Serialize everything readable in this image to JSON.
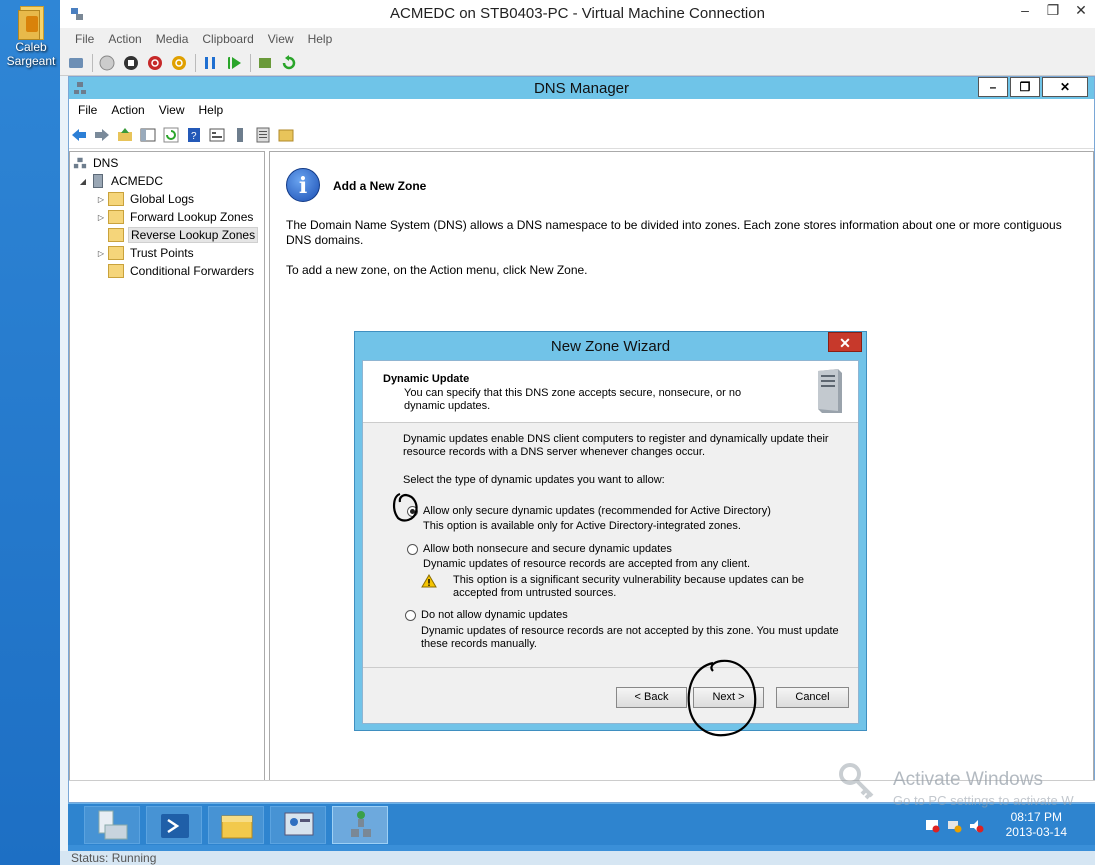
{
  "desktop": {
    "icon_label": "Caleb Sargeant"
  },
  "vm": {
    "title": "ACMEDC on STB0403-PC - Virtual Machine Connection",
    "menu": [
      "File",
      "Action",
      "Media",
      "Clipboard",
      "View",
      "Help"
    ],
    "status": "Status: Running"
  },
  "dns": {
    "title": "DNS Manager",
    "menu": [
      "File",
      "Action",
      "View",
      "Help"
    ],
    "tree": {
      "root": "DNS",
      "server": "ACMEDC",
      "items": [
        "Global Logs",
        "Forward Lookup Zones",
        "Reverse Lookup Zones",
        "Trust Points",
        "Conditional Forwarders"
      ]
    },
    "content": {
      "heading": "Add a New Zone",
      "para1": "The Domain Name System (DNS) allows a DNS namespace to be divided into zones. Each zone stores information about one or more contiguous DNS domains.",
      "para2": "To add a new zone, on the Action menu, click New Zone."
    }
  },
  "wizard": {
    "title": "New Zone Wizard",
    "header_title": "Dynamic Update",
    "header_desc": "You can specify that this DNS zone accepts secure, nonsecure, or no dynamic updates.",
    "intro": "Dynamic updates enable DNS client computers to register and dynamically update their resource records with a DNS server whenever changes occur.",
    "select_prompt": "Select the type of dynamic updates you want to allow:",
    "options": [
      {
        "label": "Allow only secure dynamic updates (recommended for Active Directory)",
        "desc": "This option is available only for Active Directory-integrated zones.",
        "checked": true
      },
      {
        "label": "Allow both nonsecure and secure dynamic updates",
        "desc": "Dynamic updates of resource records are accepted from any client.",
        "warning": "This option is a significant security vulnerability because updates can be accepted from untrusted sources.",
        "checked": false
      },
      {
        "label": "Do not allow dynamic updates",
        "desc": "Dynamic updates of resource records are not accepted by this zone. You must update these records manually.",
        "checked": false
      }
    ],
    "buttons": {
      "back": "< Back",
      "next": "Next >",
      "cancel": "Cancel"
    }
  },
  "taskbar": {
    "time": "08:17 PM",
    "date": "2013-03-14"
  },
  "watermark": {
    "line1": "Activate Windows",
    "line2": "Go to PC settings to activate W"
  },
  "icons": [
    "folder-icon",
    "info-icon",
    "server-icon",
    "warning-icon",
    "powershell-icon",
    "file-explorer-icon",
    "server-manager-icon",
    "dns-icon"
  ]
}
